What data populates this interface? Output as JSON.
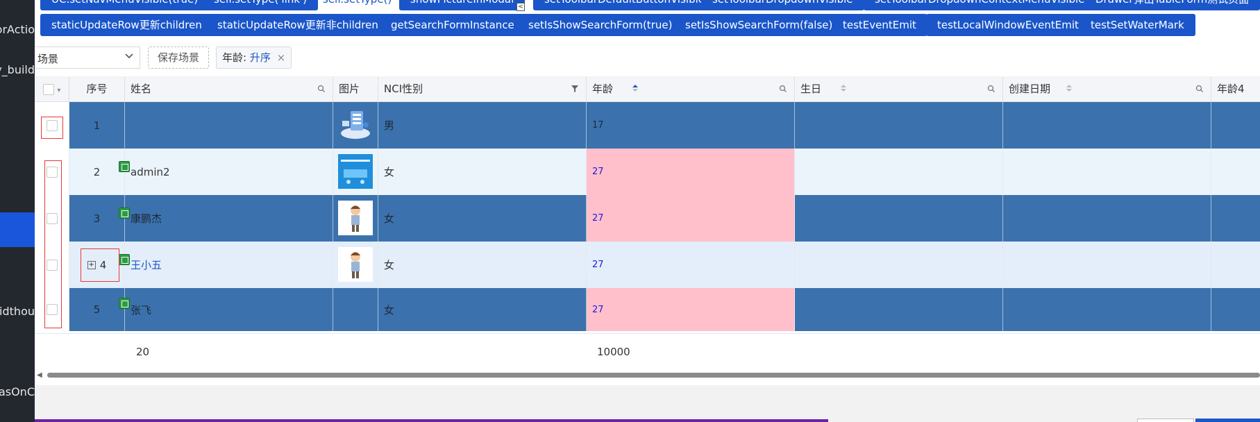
{
  "sidebar": {
    "frags": [
      "orActio",
      "y_build",
      "Widthou",
      "lasOnC"
    ]
  },
  "toolbar": {
    "row1": [
      "UC.setNavMenuVisible(true)",
      "self.setType('link')",
      "self.setType()",
      "showPictureInModal",
      "setToolbarDefaultButtonVisible",
      "setToolbarDropdownVisible",
      "setToolbarDropdownContextMenuVisible",
      "Drawer弹出TableForm测试页面"
    ],
    "row2": [
      "staticUpdateRow更新children",
      "staticUpdateRow更新非children",
      "getSearchFormInstance",
      "setIsShowSearchForm(true)",
      "setIsShowSearchForm(false)",
      "testEventEmit",
      "testLocalWindowEventEmit",
      "testSetWaterMark"
    ],
    "mini_icon": "<"
  },
  "scene": {
    "select_value": "场景",
    "save_label": "保存场景",
    "sort_tag_key": "年龄:",
    "sort_tag_value": "升序",
    "sort_tag_close": "×"
  },
  "table": {
    "headers": {
      "seq": "序号",
      "name": "姓名",
      "picture": "图片",
      "gender": "NCI性别",
      "age": "年龄",
      "birthday": "生日",
      "created": "创建日期",
      "age4": "年龄4"
    },
    "rows": [
      {
        "seq": "1",
        "name": "",
        "gender": "男",
        "age": "17",
        "style": "dark",
        "age_highlight": false,
        "name_link": false,
        "has_expand": false,
        "thumb": "server"
      },
      {
        "seq": "2",
        "name": "admin2",
        "gender": "女",
        "age": "27",
        "style": "light",
        "age_highlight": true,
        "name_link": false,
        "has_expand": false,
        "thumb": "blue"
      },
      {
        "seq": "3",
        "name": "康鹏杰",
        "gender": "女",
        "age": "27",
        "style": "dark",
        "age_highlight": true,
        "name_link": false,
        "has_expand": false,
        "thumb": "person"
      },
      {
        "seq": "4",
        "name": "王小五",
        "gender": "女",
        "age": "27",
        "style": "light",
        "age_highlight": false,
        "name_link": true,
        "has_expand": true,
        "thumb": "person"
      },
      {
        "seq": "5",
        "name": "张飞",
        "gender": "女",
        "age": "27",
        "style": "dark",
        "age_highlight": true,
        "name_link": false,
        "has_expand": false,
        "thumb": "none"
      }
    ],
    "footer": {
      "seq_sum": "20",
      "age_sum": "10000"
    },
    "expand_glyph": "+"
  },
  "colors": {
    "button": "#1a56c9",
    "row_dark": "#3b72ad",
    "row_light": "#ebf4fb",
    "age_highlight": "#ffc0cb",
    "selection_box": "#e53935"
  }
}
